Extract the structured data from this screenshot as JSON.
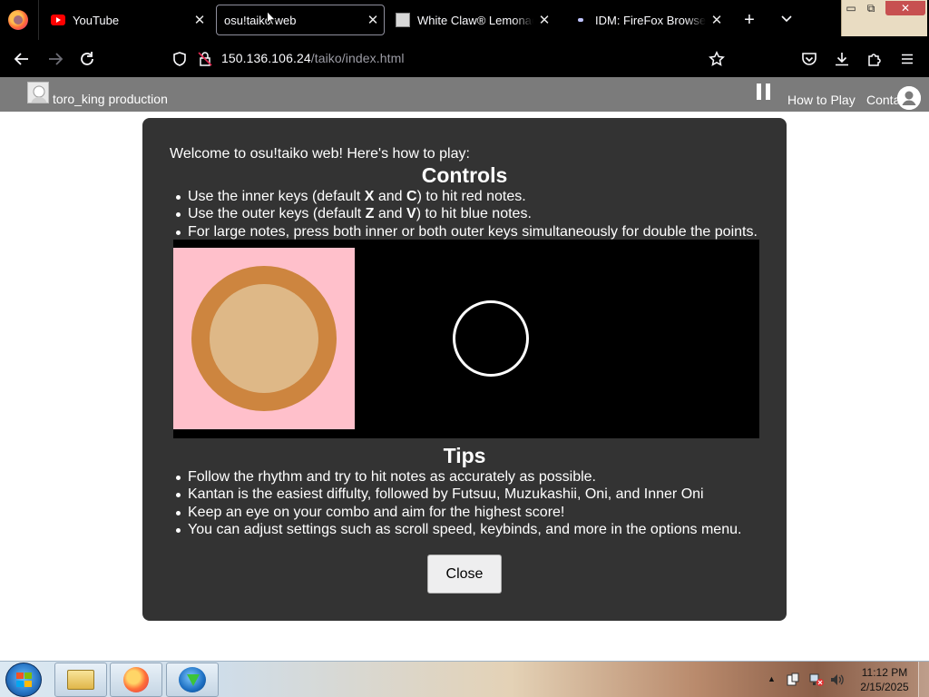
{
  "browser": {
    "tabs": [
      {
        "title": "YouTube",
        "favicon": "youtube-icon",
        "active": false
      },
      {
        "title": "osu!taiko web",
        "favicon": "none",
        "active": true
      },
      {
        "title": "White Claw® Lemonade",
        "favicon": "image-icon",
        "active": false
      },
      {
        "title": "IDM: FireFox Browser Inte",
        "favicon": "idm-icon",
        "active": false
      }
    ],
    "url": {
      "host": "150.136.106.24",
      "path": "/taiko/index.html"
    },
    "tab_close_glyph": "✕",
    "new_tab_glyph": "+",
    "tab_list_glyph": "⌄",
    "window_controls": {
      "minimize": "▭",
      "maximize": "⧉",
      "close": "✕"
    }
  },
  "site": {
    "title": "toro_king production",
    "nav": {
      "how_to_play": "How to Play",
      "contact": "Contact"
    }
  },
  "modal": {
    "intro": "Welcome to osu!taiko web! Here's how to play:",
    "controls_heading": "Controls",
    "controls": [
      {
        "before": "Use the inner keys (default ",
        "key1": "X",
        "mid": " and ",
        "key2": "C",
        "after": ") to hit red notes."
      },
      {
        "before": "Use the outer keys (default ",
        "key1": "Z",
        "mid": " and ",
        "key2": "V",
        "after": ") to hit blue notes."
      },
      {
        "text": "For large notes, press both inner or both outer keys simultaneously for double the points."
      }
    ],
    "tips_heading": "Tips",
    "tips": [
      "Follow the rhythm and try to hit notes as accurately as possible.",
      "Kantan is the easiest diffulty, followed by Futsuu, Muzukashii, Oni, and Inner Oni",
      "Keep an eye on your combo and aim for the highest score!",
      "You can adjust settings such as scroll speed, keybinds, and more in the options menu."
    ],
    "close_label": "Close",
    "colors": {
      "background": "#333333",
      "drum_bg": "#ffc0cb",
      "drum_rim": "#cd853f",
      "drum_face": "#deb887"
    }
  },
  "taskbar": {
    "pinned": [
      "explorer-icon",
      "firefox-icon",
      "idm-icon"
    ],
    "tray_arrow": "▲",
    "time": "11:12 PM",
    "date": "2/15/2025"
  }
}
